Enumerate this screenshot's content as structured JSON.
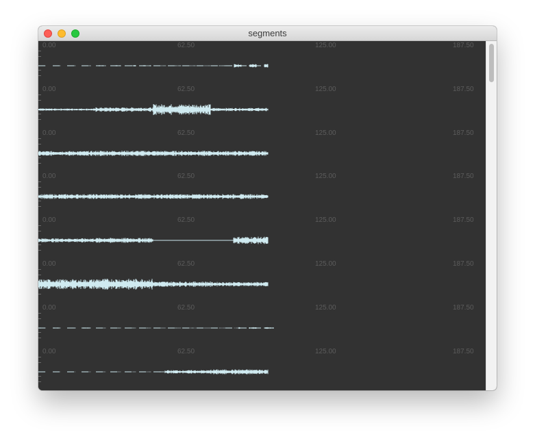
{
  "window": {
    "title": "segments"
  },
  "axis": {
    "tick_labels": [
      "0.00",
      "62.50",
      "125.00",
      "187.50"
    ]
  },
  "segments": [
    {
      "style": "dashed",
      "envelope": [
        0.6,
        0.8,
        0.5,
        0.7
      ]
    },
    {
      "style": "burst",
      "envelope": [
        0.2,
        0.4,
        1.0,
        0.3
      ]
    },
    {
      "style": "dense",
      "envelope": [
        0.7,
        0.8,
        0.75,
        0.7
      ]
    },
    {
      "style": "dense",
      "envelope": [
        0.7,
        0.7,
        0.7,
        0.7
      ]
    },
    {
      "style": "gap",
      "envelope": [
        0.5,
        0.6,
        0.0,
        0.9
      ]
    },
    {
      "style": "burst",
      "envelope": [
        0.9,
        1.0,
        0.5,
        0.4
      ]
    },
    {
      "style": "dashed",
      "envelope": [
        0.7,
        0.5,
        0.4,
        0.3
      ]
    },
    {
      "style": "dashed-burst",
      "envelope": [
        0.2,
        0.3,
        0.7,
        1.0
      ]
    }
  ],
  "colors": {
    "background": "#323232",
    "waveform": "#cfeaf0",
    "tick_label": "#5c5c5c"
  }
}
